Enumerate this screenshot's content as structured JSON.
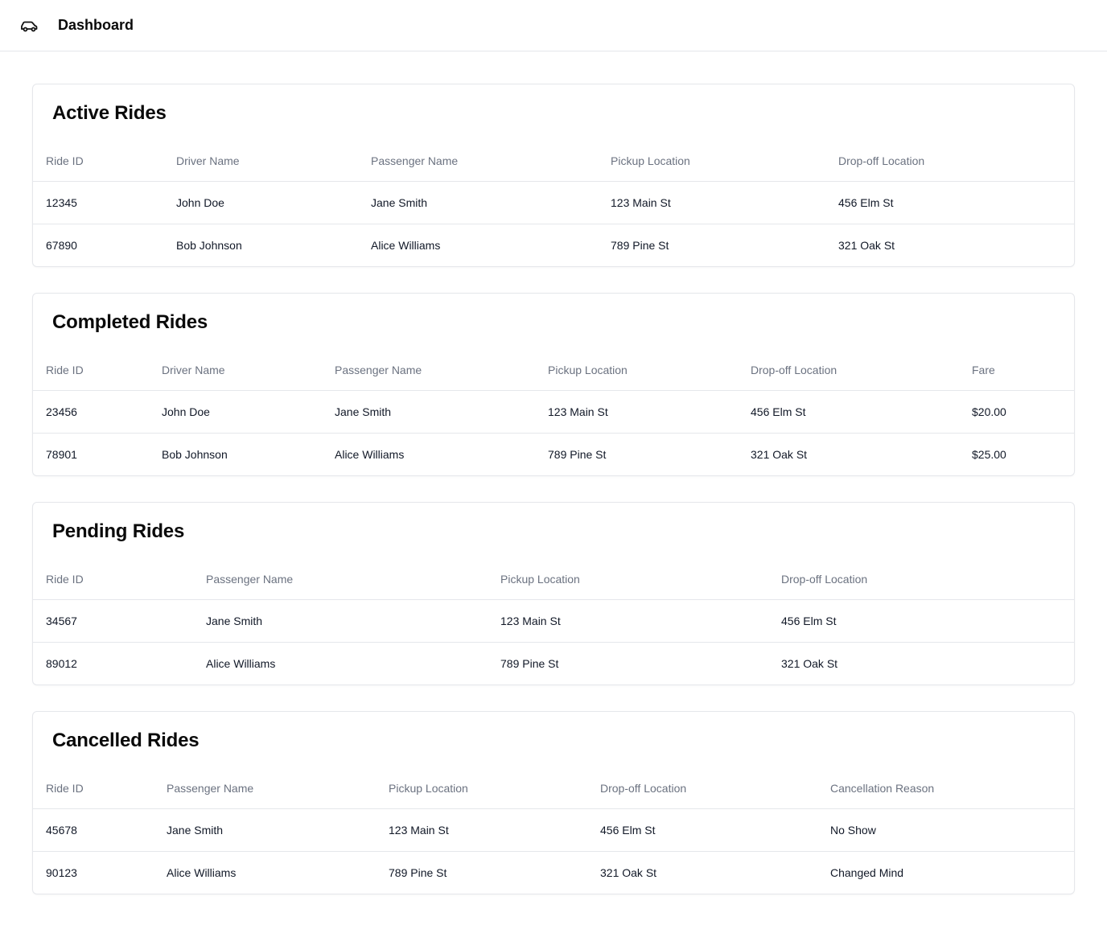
{
  "header": {
    "title": "Dashboard",
    "icon": "car-icon"
  },
  "active": {
    "title": "Active Rides",
    "columns": [
      "Ride ID",
      "Driver Name",
      "Passenger Name",
      "Pickup Location",
      "Drop-off Location"
    ],
    "rows": [
      [
        "12345",
        "John Doe",
        "Jane Smith",
        "123 Main St",
        "456 Elm St"
      ],
      [
        "67890",
        "Bob Johnson",
        "Alice Williams",
        "789 Pine St",
        "321 Oak St"
      ]
    ]
  },
  "completed": {
    "title": "Completed Rides",
    "columns": [
      "Ride ID",
      "Driver Name",
      "Passenger Name",
      "Pickup Location",
      "Drop-off Location",
      "Fare"
    ],
    "rows": [
      [
        "23456",
        "John Doe",
        "Jane Smith",
        "123 Main St",
        "456 Elm St",
        "$20.00"
      ],
      [
        "78901",
        "Bob Johnson",
        "Alice Williams",
        "789 Pine St",
        "321 Oak St",
        "$25.00"
      ]
    ]
  },
  "pending": {
    "title": "Pending Rides",
    "columns": [
      "Ride ID",
      "Passenger Name",
      "Pickup Location",
      "Drop-off Location"
    ],
    "rows": [
      [
        "34567",
        "Jane Smith",
        "123 Main St",
        "456 Elm St"
      ],
      [
        "89012",
        "Alice Williams",
        "789 Pine St",
        "321 Oak St"
      ]
    ]
  },
  "cancelled": {
    "title": "Cancelled Rides",
    "columns": [
      "Ride ID",
      "Passenger Name",
      "Pickup Location",
      "Drop-off Location",
      "Cancellation Reason"
    ],
    "rows": [
      [
        "45678",
        "Jane Smith",
        "123 Main St",
        "456 Elm St",
        "No Show"
      ],
      [
        "90123",
        "Alice Williams",
        "789 Pine St",
        "321 Oak St",
        "Changed Mind"
      ]
    ]
  }
}
